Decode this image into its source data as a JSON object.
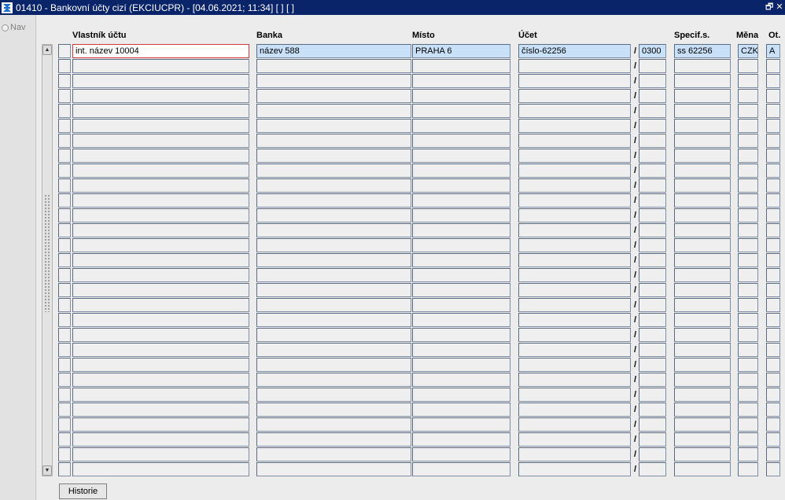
{
  "window": {
    "title": "01410 - Bankovní účty cizí (EKCIUCPR) - [04.06.2021; 11:34]  [ ]  [ ]",
    "restore_glyph": "🗗",
    "close_glyph": "✕"
  },
  "nav": {
    "label": "Nav"
  },
  "columns": {
    "owner": "Vlastník účtu",
    "bank": "Banka",
    "place": "Místo",
    "account": "Účet",
    "spec": "Specif.s.",
    "currency": "Měna",
    "ot": "Ot."
  },
  "rows": [
    {
      "owner": "int. název 10004",
      "bank": "název 588",
      "place": "PRAHA 6",
      "account": "číslo-62256",
      "bank_code": "0300",
      "spec": "ss 62256",
      "currency": "CZK",
      "ot": "A"
    }
  ],
  "empty_row_count": 28,
  "separator": "/",
  "scroll": {
    "up": "▲",
    "down": "▼"
  },
  "buttons": {
    "historie": "Historie"
  }
}
